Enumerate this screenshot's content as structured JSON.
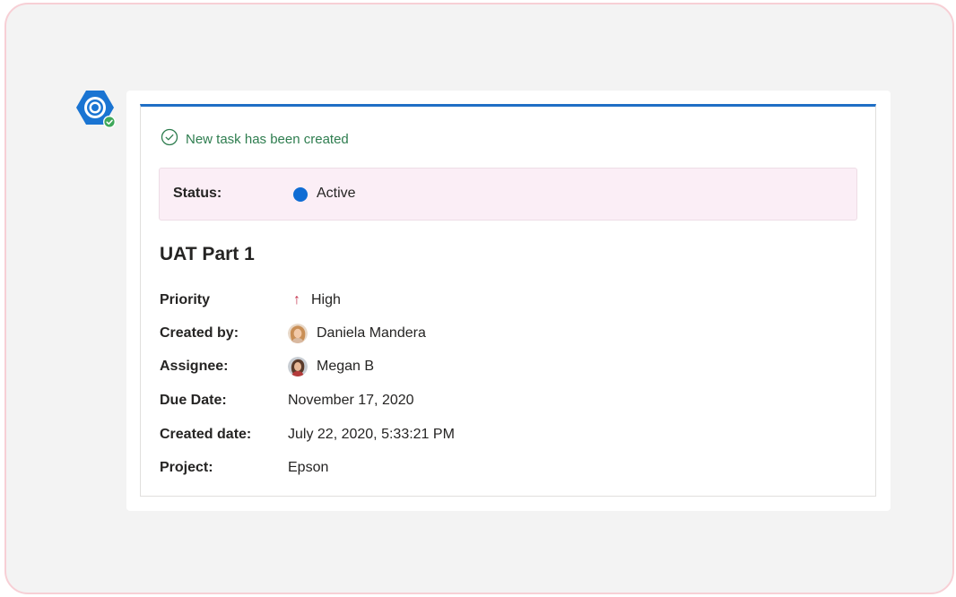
{
  "notification": {
    "text": "New task has been created",
    "icon": "check-circle-icon",
    "color": "#2e7d4f"
  },
  "app": {
    "icon": "app-hexagon-logo-icon",
    "badge_icon": "checkmark-badge-icon"
  },
  "status": {
    "label": "Status:",
    "value": "Active",
    "dot_color": "#0f6cd4"
  },
  "task": {
    "title": "UAT Part 1",
    "fields": {
      "priority": {
        "label": "Priority",
        "value": "High",
        "icon": "arrow-up-icon",
        "icon_glyph": "↑"
      },
      "created_by": {
        "label": "Created by:",
        "value": "Daniela Mandera",
        "avatar": "avatar-daniela"
      },
      "assignee": {
        "label": "Assignee:",
        "value": "Megan B",
        "avatar": "avatar-megan"
      },
      "due_date": {
        "label": "Due Date:",
        "value": "November 17, 2020"
      },
      "created_date": {
        "label": "Created date:",
        "value": "July 22, 2020, 5:33:21 PM"
      },
      "project": {
        "label": "Project:",
        "value": "Epson"
      }
    }
  },
  "colors": {
    "accent": "#1f6fc5",
    "status_background": "#fbeef6",
    "priority_high": "#c4314b"
  }
}
